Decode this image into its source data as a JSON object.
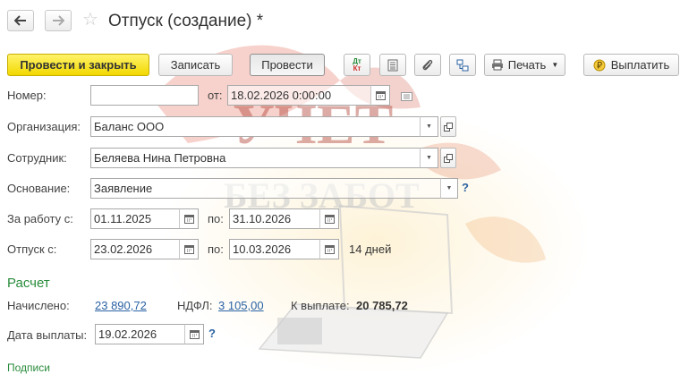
{
  "header": {
    "title": "Отпуск (создание) *"
  },
  "toolbar": {
    "post_close_label": "Провести и закрыть",
    "save_label": "Записать",
    "post_label": "Провести",
    "dtkt_label_top": "Дт",
    "dtkt_label_bottom": "Кт",
    "print_label": "Печать",
    "pay_label": "Выплатить"
  },
  "form": {
    "number_label": "Номер:",
    "number_value": "",
    "date_label": "от:",
    "date_value": "18.02.2026  0:00:00",
    "org_label": "Организация:",
    "org_value": "Баланс ООО",
    "employee_label": "Сотрудник:",
    "employee_value": "Беляева Нина Петровна",
    "basis_label": "Основание:",
    "basis_value": "Заявление",
    "work_period_label": "За работу с:",
    "work_from": "01.11.2025",
    "work_to_label": "по:",
    "work_to": "31.10.2026",
    "vacation_label": "Отпуск с:",
    "vacation_from": "23.02.2026",
    "vacation_to_label": "по:",
    "vacation_to": "10.03.2026",
    "vacation_days": "14 дней"
  },
  "calc": {
    "section_title": "Расчет",
    "accrued_label": "Начислено:",
    "accrued_value": "23 890,72",
    "ndfl_label": "НДФЛ:",
    "ndfl_value": "3 105,00",
    "payout_label": "К выплате:",
    "payout_value": "20 785,72",
    "pay_date_label": "Дата выплаты:",
    "pay_date_value": "19.02.2026",
    "help": "?"
  },
  "footer": {
    "signatures_label": "Подписи"
  },
  "watermark": {
    "line1": "УЧЕТ",
    "line2": "БЕЗ ЗАБОТ"
  }
}
